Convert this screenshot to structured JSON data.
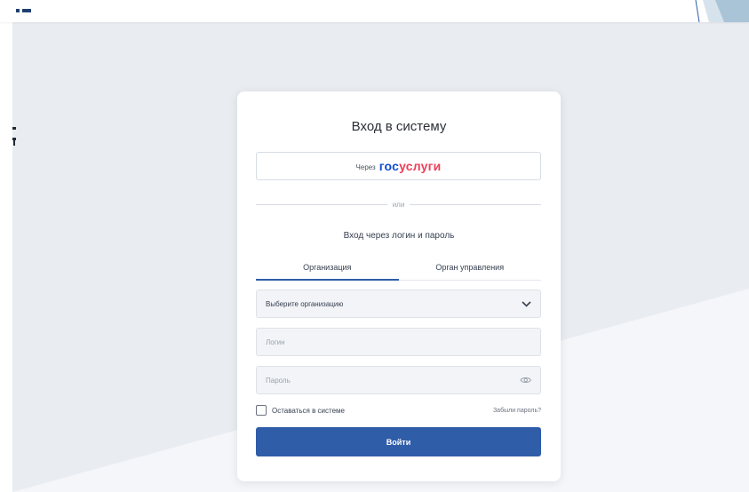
{
  "colors": {
    "accent": "#2f5da8",
    "gosuslugi_blue": "#0d4cd3",
    "gosuslugi_red": "#ee3f58",
    "page_background": "#e9ecf1",
    "field_background": "#f2f4f7"
  },
  "icons": {
    "logo": "app-logo-icon",
    "dropdown": "chevron-down-icon",
    "password_toggle": "eye-icon"
  },
  "login": {
    "title": "Вход в систему",
    "gosuslugi": {
      "via": "Через",
      "brand_part1": "гос",
      "brand_part2": "услуги"
    },
    "divider": "или",
    "subtitle": "Вход через логин и пароль",
    "tabs": [
      {
        "label": "Организация",
        "active": true
      },
      {
        "label": "Орган управления",
        "active": false
      }
    ],
    "organization_select": {
      "value": "Выберите организацию"
    },
    "login_field": {
      "placeholder": "Логин",
      "value": ""
    },
    "password_field": {
      "placeholder": "Пароль",
      "value": ""
    },
    "remember": {
      "label": "Оставаться в системе",
      "checked": false
    },
    "forgot": "Забыли пароль?",
    "submit": "Войти"
  }
}
